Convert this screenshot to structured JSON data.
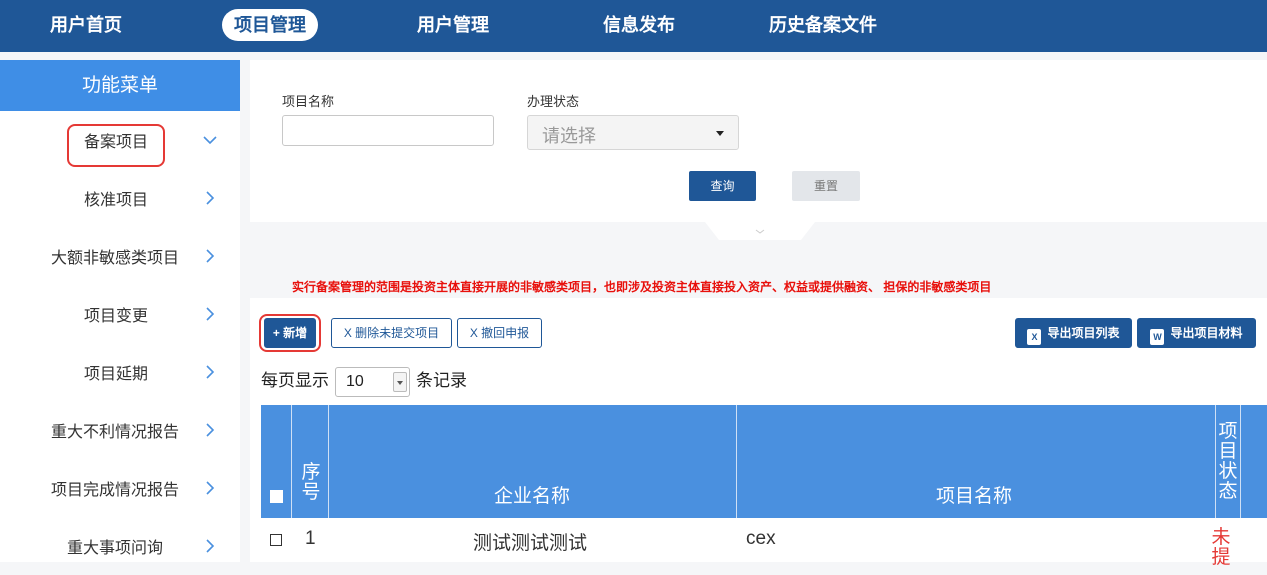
{
  "topnav": {
    "items": [
      {
        "label": "用户首页",
        "active": false
      },
      {
        "label": "项目管理",
        "active": true
      },
      {
        "label": "用户管理",
        "active": false
      },
      {
        "label": "信息发布",
        "active": false
      },
      {
        "label": "历史备案文件",
        "active": false
      }
    ]
  },
  "sidebar": {
    "title": "功能菜单",
    "items": [
      {
        "label": "备案项目",
        "icon": "chevron-down-icon",
        "highlighted": true
      },
      {
        "label": "核准项目",
        "icon": "chevron-right-icon"
      },
      {
        "label": "大额非敏感类项目",
        "icon": "chevron-right-icon"
      },
      {
        "label": "项目变更",
        "icon": "chevron-right-icon"
      },
      {
        "label": "项目延期",
        "icon": "chevron-right-icon"
      },
      {
        "label": "重大不利情况报告",
        "icon": "chevron-right-icon"
      },
      {
        "label": "项目完成情况报告",
        "icon": "chevron-right-icon"
      },
      {
        "label": "重大事项问询",
        "icon": "chevron-right-icon"
      }
    ]
  },
  "search": {
    "project_name_label": "项目名称",
    "project_name_value": "",
    "status_label": "办理状态",
    "status_placeholder": "请选择",
    "query_label": "查询",
    "reset_label": "重置"
  },
  "notice": "实行备案管理的范围是投资主体直接开展的非敏感类项目，也即涉及投资主体直接投入资产、权益或提供融资、 担保的非敏感类项目",
  "toolbar": {
    "add_label": "+ 新增",
    "delete_label": "X 删除未提交项目",
    "withdraw_label": "X 撤回申报",
    "export_list_label": "导出项目列表",
    "export_materials_label": "导出项目材料",
    "excel_icon": "X",
    "word_icon": "W"
  },
  "pager": {
    "prefix": "每页显示",
    "page_size": "10",
    "suffix": "条记录"
  },
  "table": {
    "headers": {
      "index": "序号",
      "company": "企业名称",
      "project": "项目名称",
      "status": "项目状态"
    },
    "rows": [
      {
        "index": "1",
        "company": "测试测试测试",
        "project": "cex",
        "status": "未提"
      }
    ]
  },
  "colors": {
    "nav": "#1f5797",
    "menu_title": "#3f8ee6",
    "table_header": "#4a90df",
    "notice": "#e8100c",
    "highlight": "#e53935"
  }
}
